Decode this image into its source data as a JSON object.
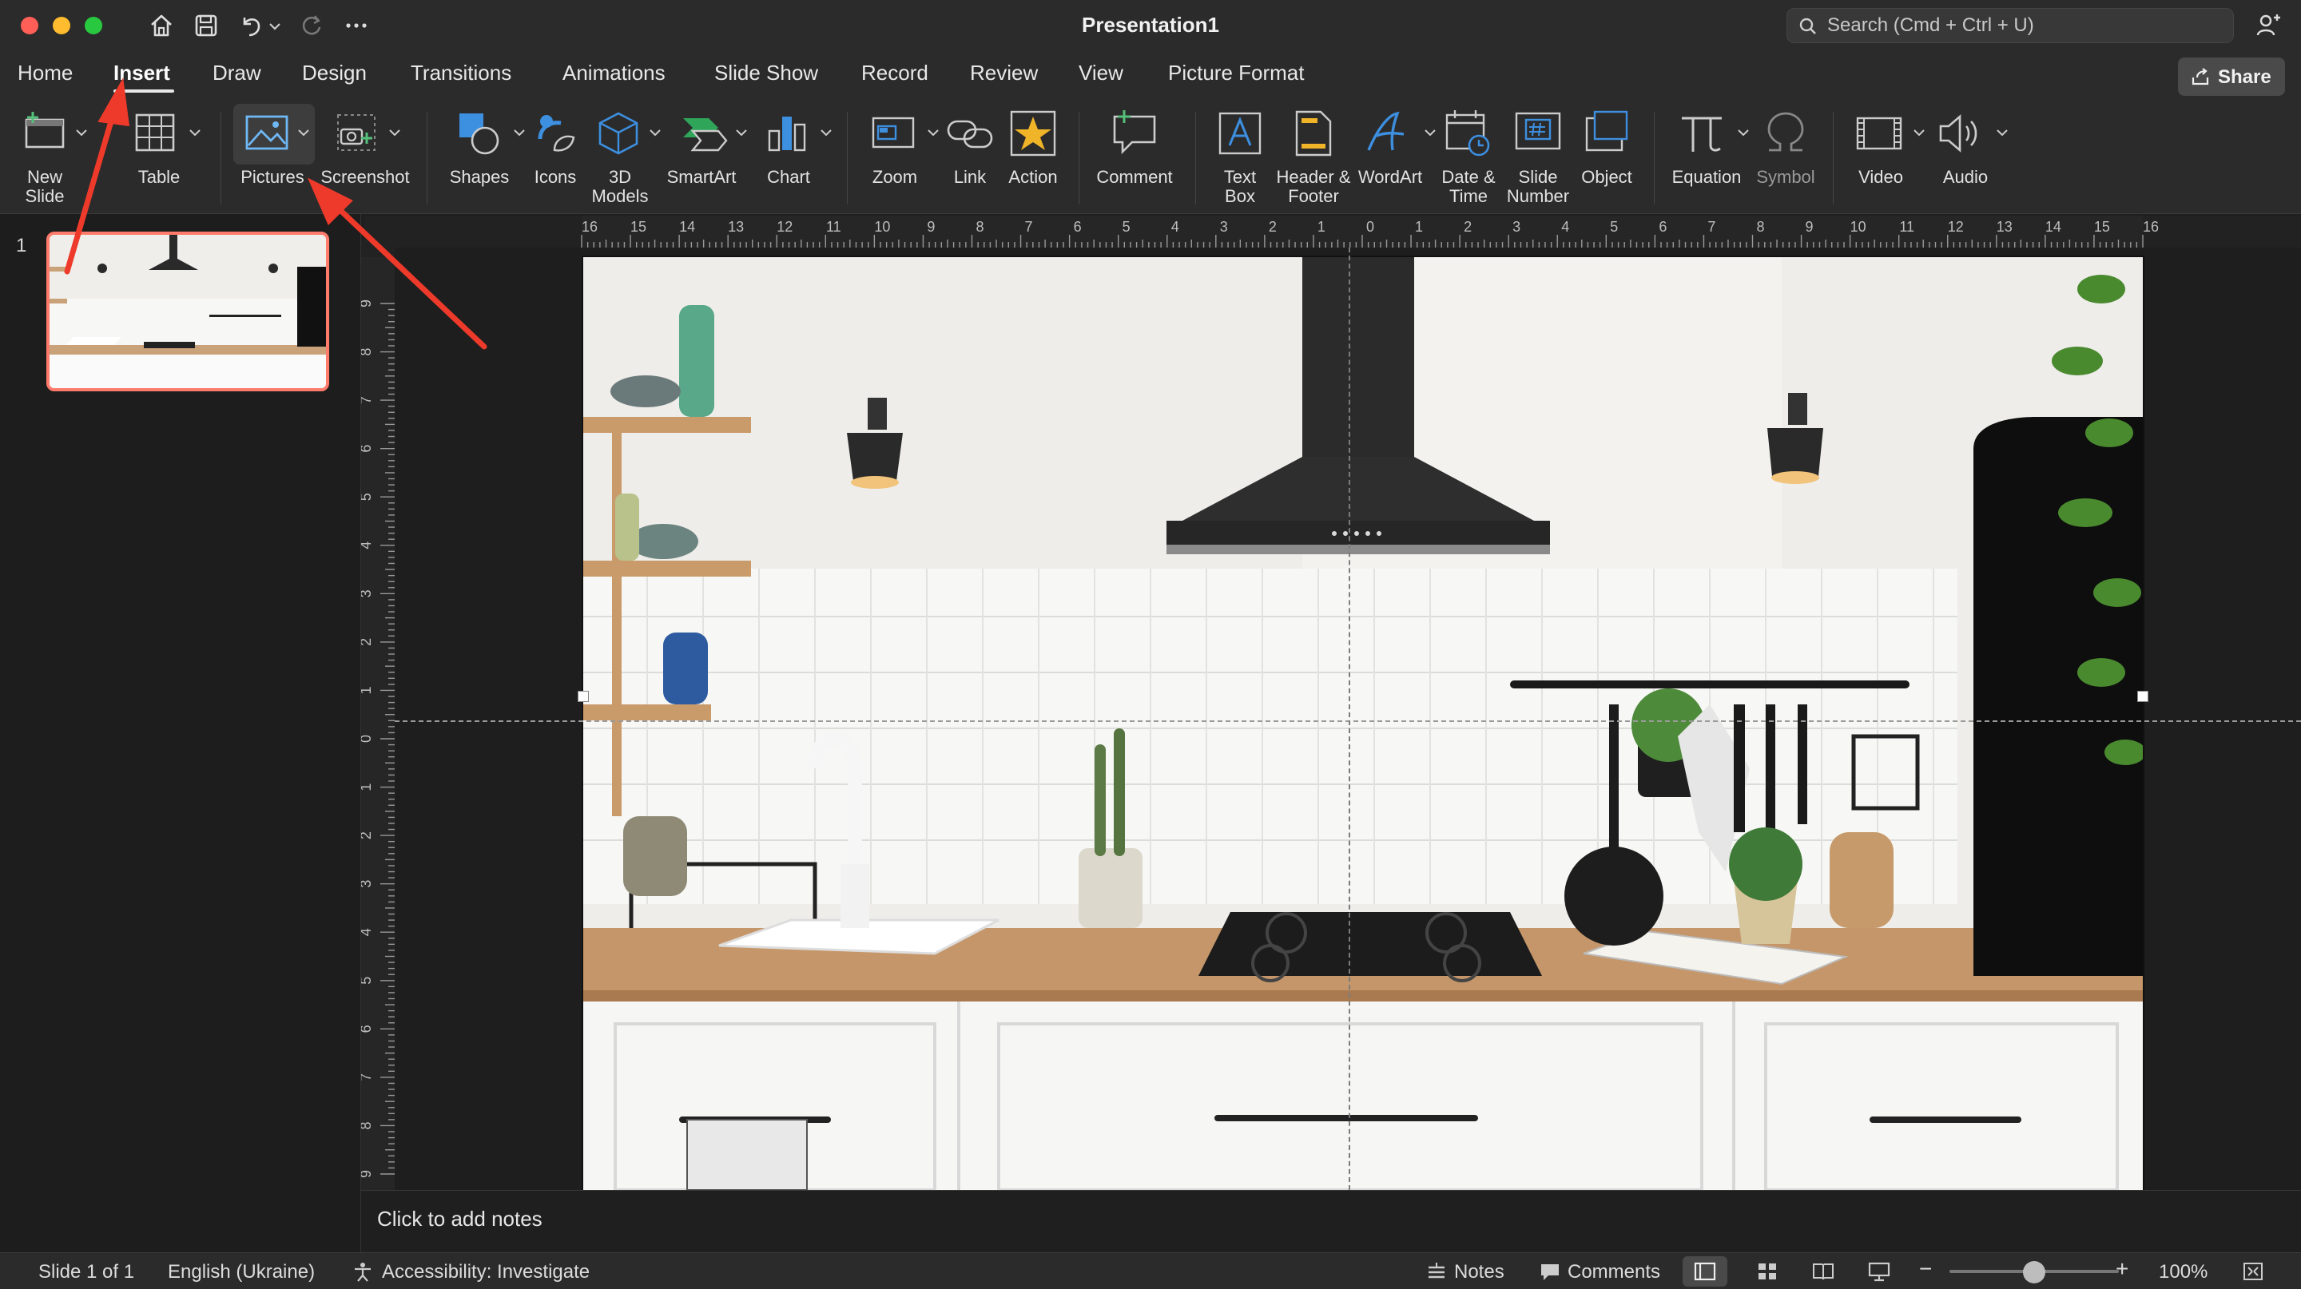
{
  "window": {
    "title": "Presentation1",
    "search_placeholder": "Search (Cmd + Ctrl + U)"
  },
  "tabs": [
    {
      "label": "Home"
    },
    {
      "label": "Insert",
      "active": true
    },
    {
      "label": "Draw"
    },
    {
      "label": "Design"
    },
    {
      "label": "Transitions"
    },
    {
      "label": "Animations"
    },
    {
      "label": "Slide Show"
    },
    {
      "label": "Record"
    },
    {
      "label": "Review"
    },
    {
      "label": "View"
    },
    {
      "label": "Picture Format"
    }
  ],
  "share_label": "Share",
  "ribbon": {
    "new_slide": "New\nSlide",
    "table": "Table",
    "pictures": "Pictures",
    "screenshot": "Screenshot",
    "shapes": "Shapes",
    "icons": "Icons",
    "models3d": "3D\nModels",
    "smartart": "SmartArt",
    "chart": "Chart",
    "zoom": "Zoom",
    "link": "Link",
    "action": "Action",
    "comment": "Comment",
    "textbox": "Text\nBox",
    "header_footer": "Header &\nFooter",
    "wordart": "WordArt",
    "datetime": "Date &\nTime",
    "slide_number": "Slide\nNumber",
    "object": "Object",
    "equation": "Equation",
    "symbol": "Symbol",
    "video": "Video",
    "audio": "Audio"
  },
  "thumbnails": [
    {
      "number": "1"
    }
  ],
  "ruler_top_labels": [
    "16",
    "15",
    "14",
    "13",
    "12",
    "11",
    "10",
    "9",
    "8",
    "7",
    "6",
    "5",
    "4",
    "3",
    "2",
    "1",
    "0",
    "1",
    "2",
    "3",
    "4",
    "5",
    "6",
    "7",
    "8",
    "9",
    "10",
    "11",
    "12",
    "13",
    "14",
    "15",
    "16"
  ],
  "ruler_left_labels": [
    "9",
    "8",
    "7",
    "6",
    "5",
    "4",
    "3",
    "2",
    "1",
    "0",
    "1",
    "2",
    "3",
    "4",
    "5",
    "6",
    "7",
    "8",
    "9"
  ],
  "notes_placeholder": "Click to add notes",
  "status": {
    "slide_info": "Slide 1 of 1",
    "language": "English (Ukraine)",
    "accessibility": "Accessibility: Investigate",
    "notes": "Notes",
    "comments": "Comments",
    "zoom": "100%",
    "zoom_level": 0.5
  },
  "colors": {
    "accent_selection": "#ff7b6b",
    "annotation_arrow": "#ee3a2a",
    "chrome_bg": "#2b2b2b"
  }
}
